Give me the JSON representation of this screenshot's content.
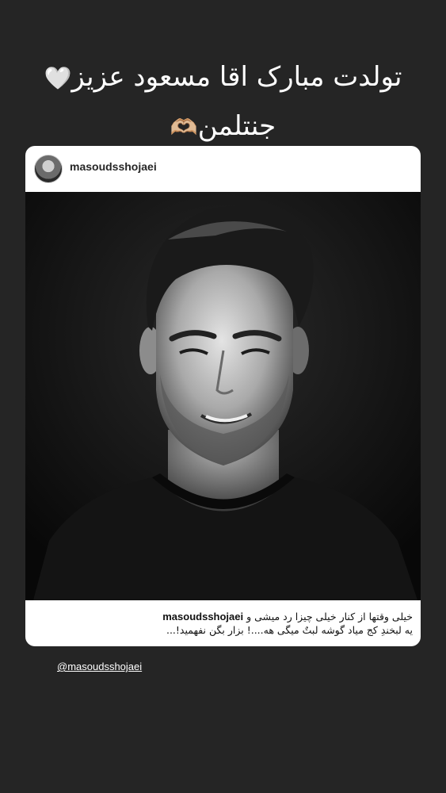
{
  "story": {
    "line1": "تولدت مبارک اقا مسعود عزیز",
    "line1_emoji": "🤍",
    "line2": "جنتلمن",
    "line2_emoji": "🫶🏼"
  },
  "post": {
    "username": "masoudsshojaei",
    "caption_user": "masoudsshojaei",
    "caption_line1": "خیلی وقتها از کنار خیلی چیزا رد میشی و",
    "caption_line2": "یه لبخندِ کج میاد گوشه لبتٌ میگی هه....! بزار بگن نفهمید!..."
  },
  "mention": "@masoudsshojaei",
  "colors": {
    "background": "#252525",
    "card": "#ffffff",
    "photo_bg": "#0c0c0c"
  }
}
